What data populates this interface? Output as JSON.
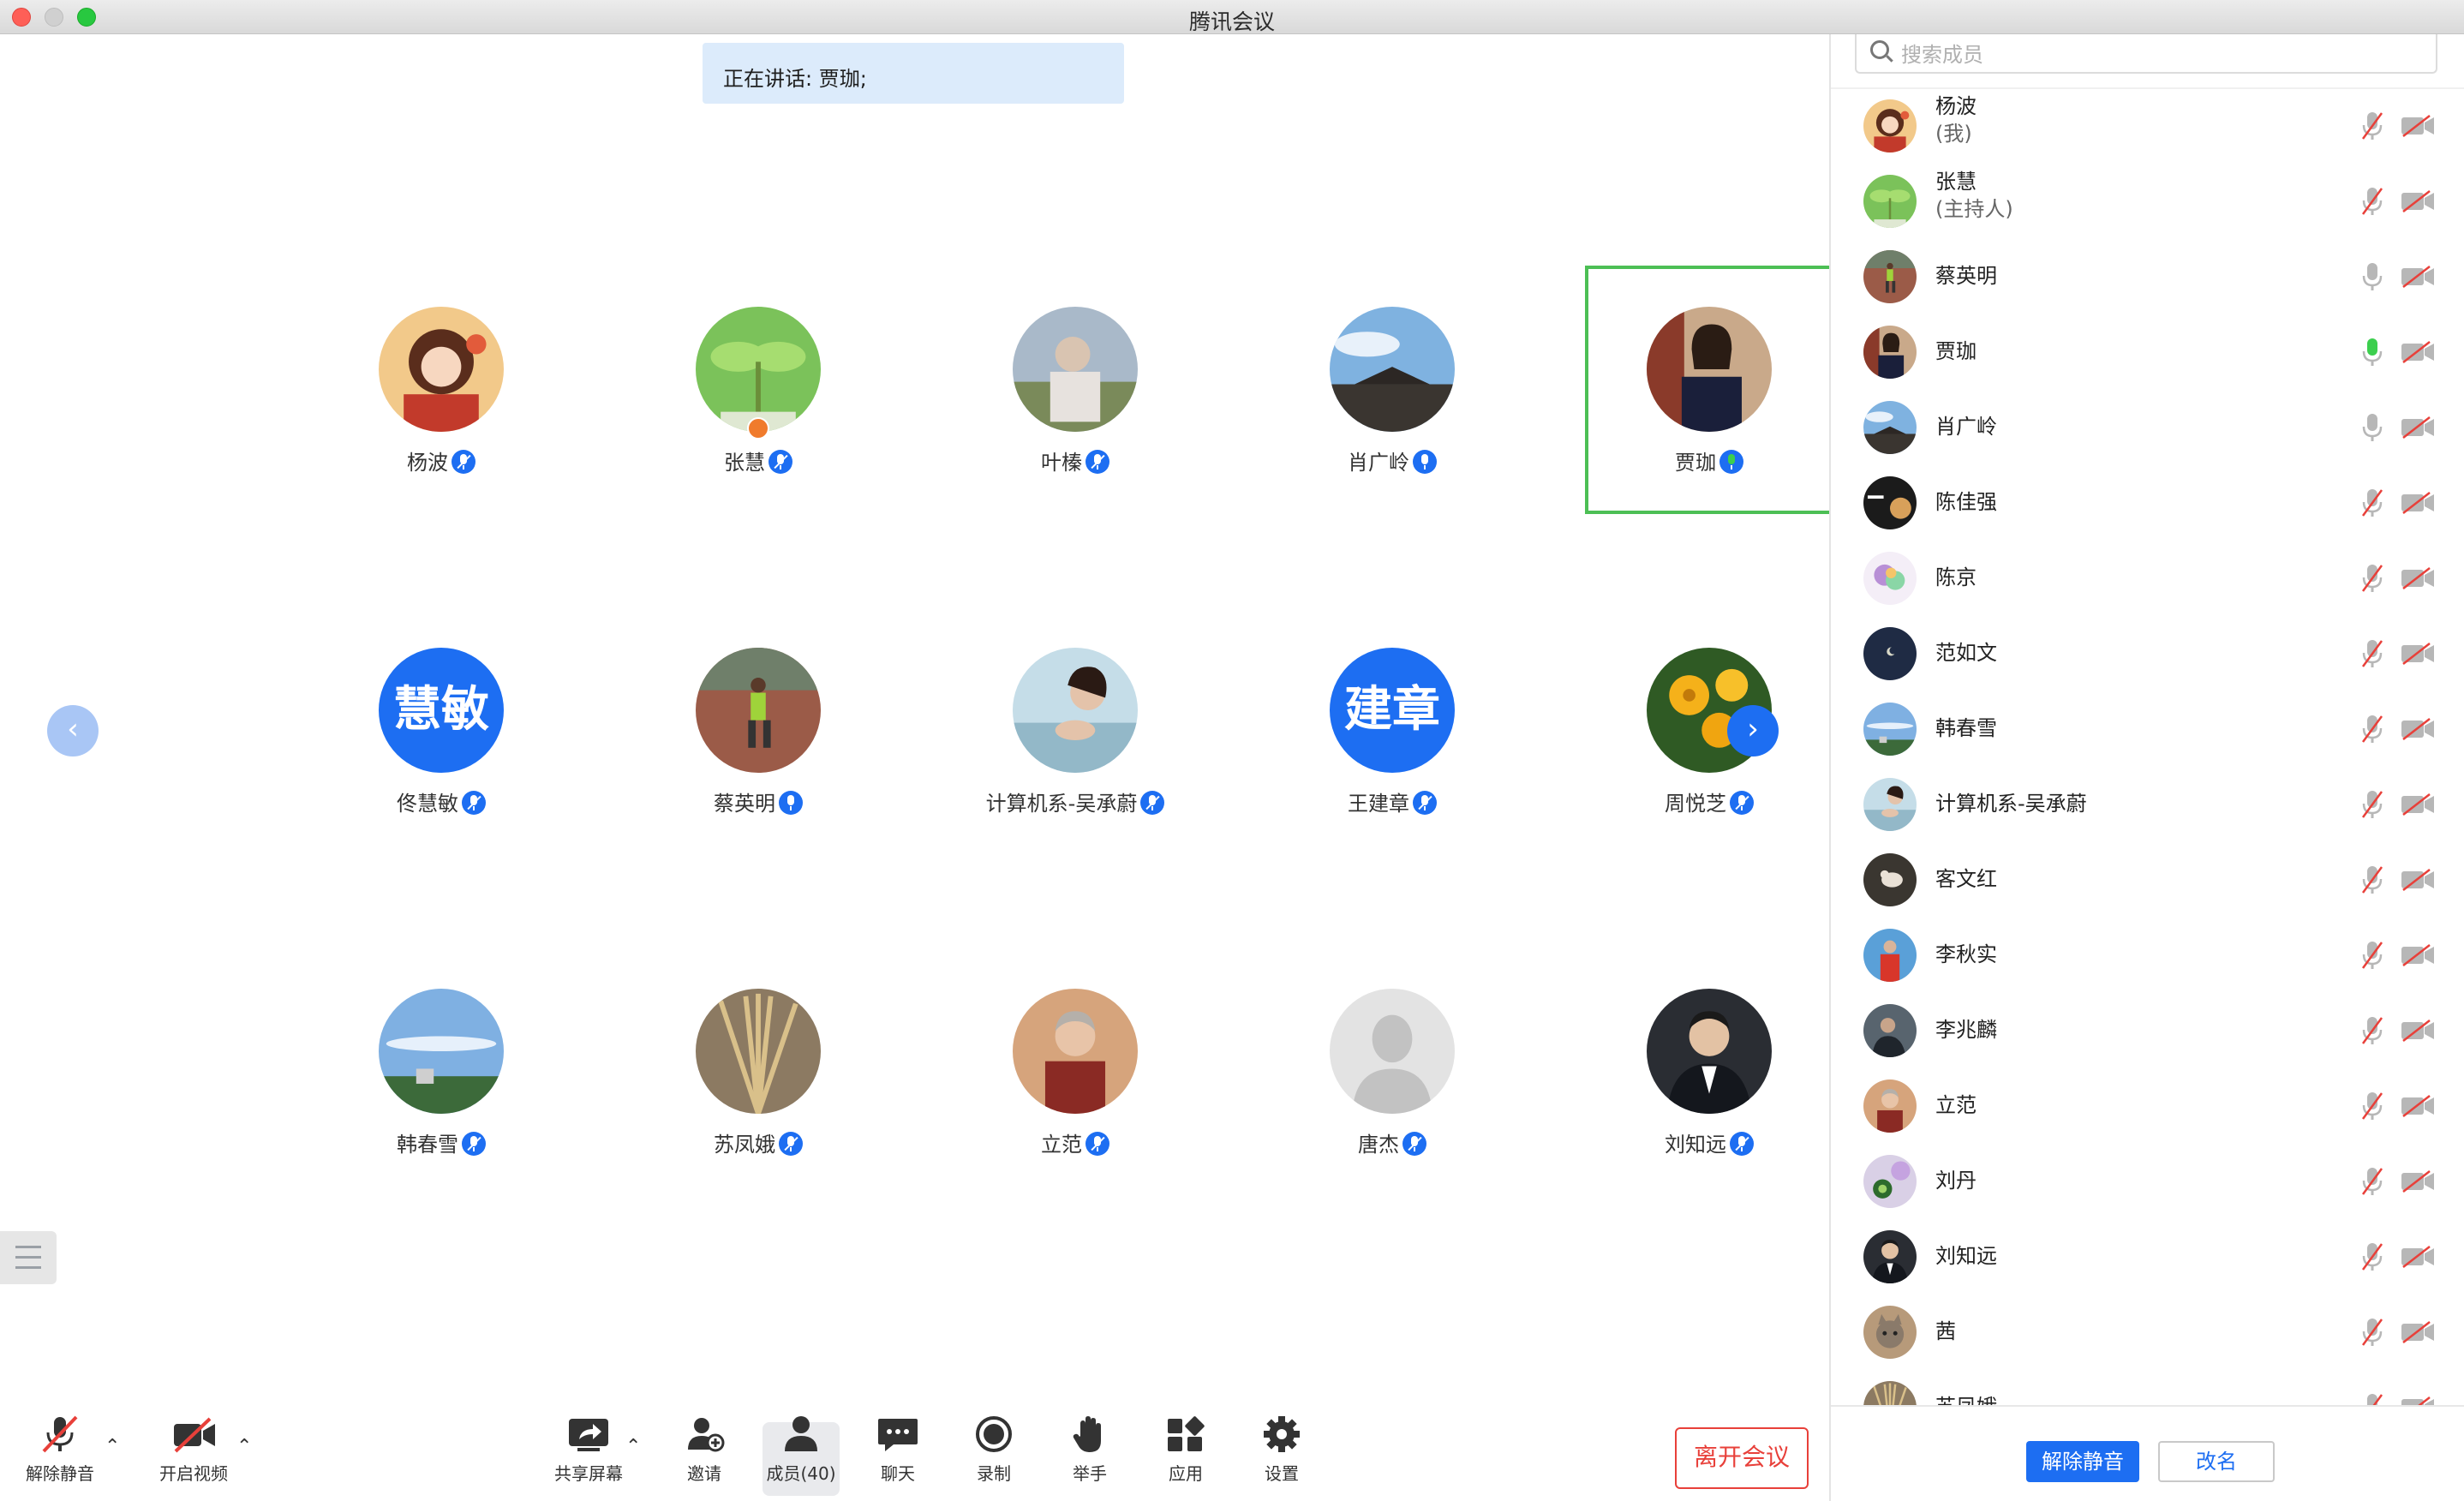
{
  "window": {
    "title": "腾讯会议"
  },
  "stage": {
    "speaking_banner": "正在讲话: 贾珈;",
    "participants": [
      {
        "name": "杨波",
        "mic": "muted",
        "avatar": "cartoon-girl"
      },
      {
        "name": "张慧",
        "mic": "muted",
        "avatar": "sprout",
        "host": true
      },
      {
        "name": "叶榛",
        "mic": "muted",
        "avatar": "elder-photo"
      },
      {
        "name": "肖广岭",
        "mic": "on",
        "avatar": "building-sky"
      },
      {
        "name": "贾珈",
        "mic": "speaking",
        "avatar": "woman-photo",
        "active_speaker": true
      },
      {
        "name": "佟慧敏",
        "mic": "muted",
        "avatar_text": "慧敏"
      },
      {
        "name": "蔡英明",
        "mic": "on",
        "avatar": "runner"
      },
      {
        "name": "计算机系-吴承蔚",
        "mic": "muted",
        "avatar": "girl-water"
      },
      {
        "name": "王建章",
        "mic": "muted",
        "avatar_text": "建章"
      },
      {
        "name": "周悦芝",
        "mic": "muted",
        "avatar": "yellow-flowers"
      },
      {
        "name": "韩春雪",
        "mic": "muted",
        "avatar": "sky-trees"
      },
      {
        "name": "苏凤娥",
        "mic": "muted",
        "avatar": "wheat"
      },
      {
        "name": "立范",
        "mic": "muted",
        "avatar": "elder-woman"
      },
      {
        "name": "唐杰",
        "mic": "muted",
        "avatar": "default-person"
      },
      {
        "name": "刘知远",
        "mic": "muted",
        "avatar": "man-suit"
      }
    ]
  },
  "toolbar": {
    "unmute": "解除静音",
    "start_video": "开启视频",
    "share_screen": "共享屏幕",
    "invite": "邀请",
    "members": "成员(40)",
    "chat": "聊天",
    "record": "录制",
    "raise_hand": "举手",
    "apps": "应用",
    "settings": "设置",
    "leave": "离开会议"
  },
  "panel": {
    "search_placeholder": "搜索成员",
    "members": [
      {
        "name": "杨波",
        "role": "(我)",
        "mic": "muted",
        "avatar": "cartoon-girl"
      },
      {
        "name": "张慧",
        "role": "(主持人)",
        "mic": "muted",
        "avatar": "sprout"
      },
      {
        "name": "蔡英明",
        "mic": "on",
        "avatar": "runner"
      },
      {
        "name": "贾珈",
        "mic": "speaking",
        "avatar": "woman-photo"
      },
      {
        "name": "肖广岭",
        "mic": "on",
        "avatar": "building-sky"
      },
      {
        "name": "陈佳强",
        "mic": "muted",
        "avatar": "dark-text"
      },
      {
        "name": "陈京",
        "mic": "muted",
        "avatar": "colorful"
      },
      {
        "name": "范如文",
        "mic": "muted",
        "avatar": "night-moon"
      },
      {
        "name": "韩春雪",
        "mic": "muted",
        "avatar": "sky-trees"
      },
      {
        "name": "计算机系-吴承蔚",
        "mic": "muted",
        "avatar": "girl-water"
      },
      {
        "name": "客文红",
        "mic": "muted",
        "avatar": "dark-bird"
      },
      {
        "name": "李秋实",
        "mic": "muted",
        "avatar": "red-runner"
      },
      {
        "name": "李兆麟",
        "mic": "muted",
        "avatar": "dark-man"
      },
      {
        "name": "立范",
        "mic": "muted",
        "avatar": "elder-woman"
      },
      {
        "name": "刘丹",
        "mic": "muted",
        "avatar": "green-circle"
      },
      {
        "name": "刘知远",
        "mic": "muted",
        "avatar": "man-suit"
      },
      {
        "name": "茜",
        "mic": "muted",
        "avatar": "cat"
      },
      {
        "name": "苏凤娥",
        "mic": "muted",
        "avatar": "wheat"
      }
    ],
    "unmute_all": "解除静音",
    "rename": "改名"
  },
  "colors": {
    "accent": "#1d6ef2",
    "active_border": "#4cbf55",
    "leave": "#e8403a",
    "speaking_mic": "#3ccf4e"
  }
}
